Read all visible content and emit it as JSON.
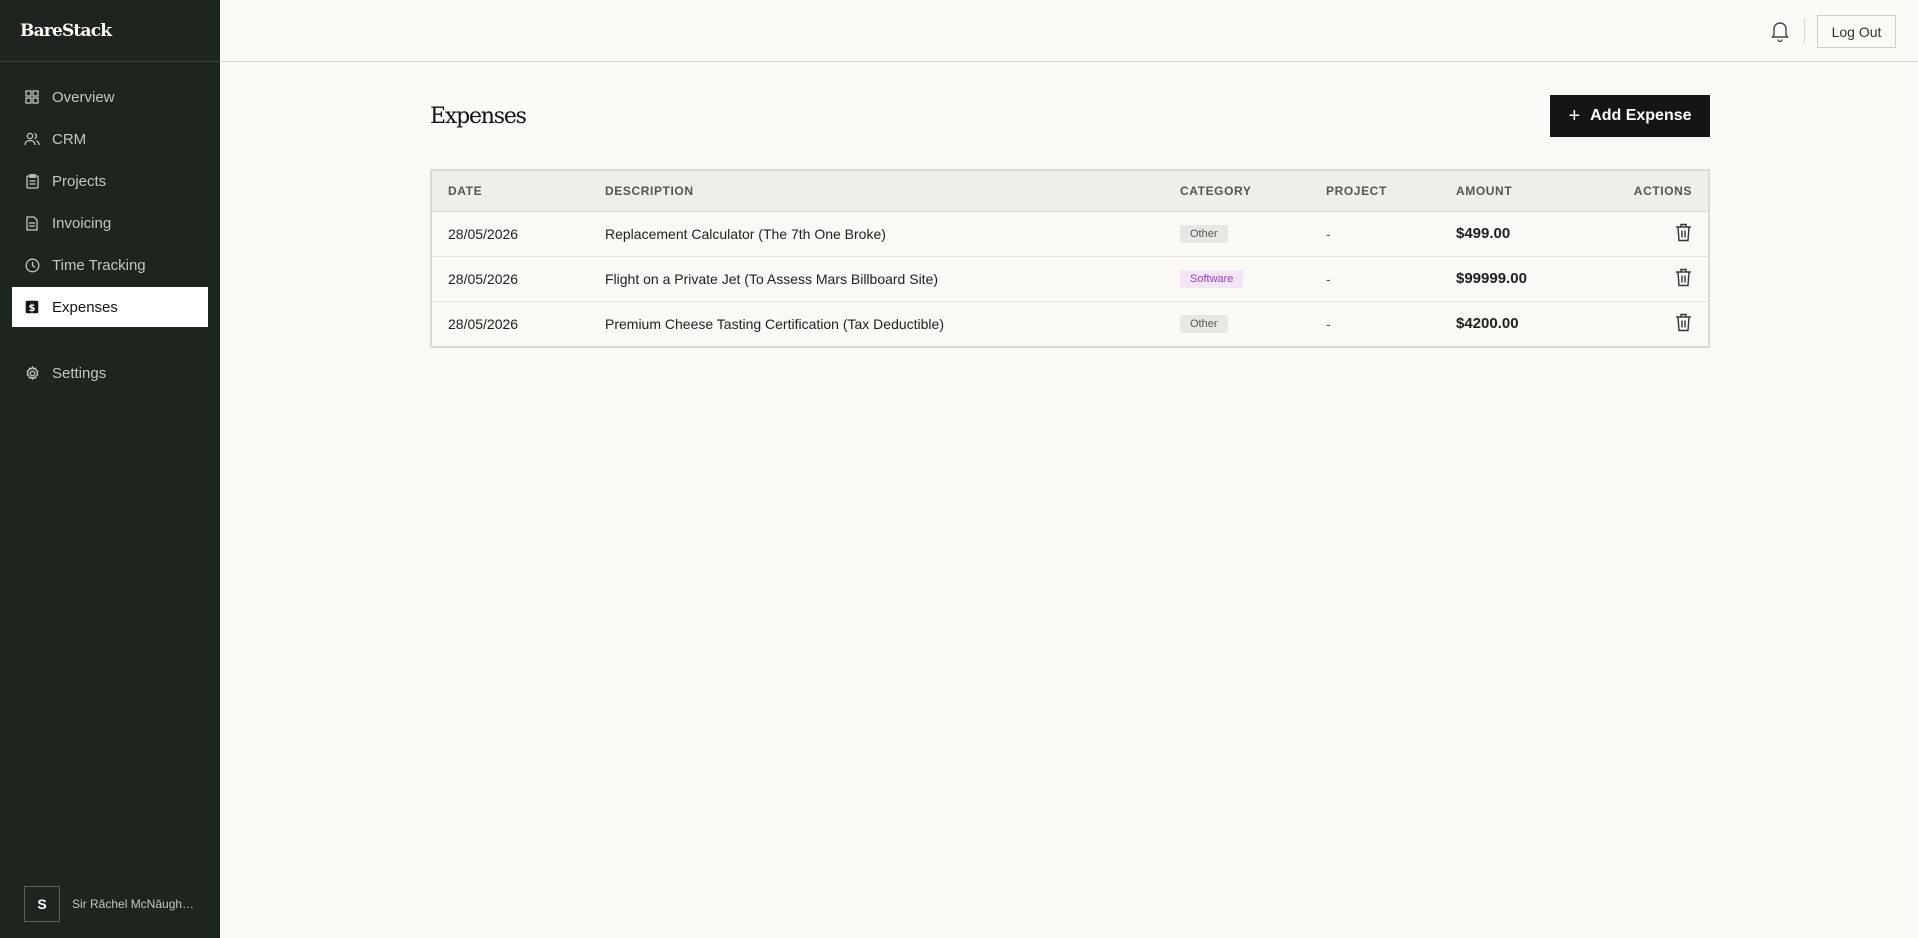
{
  "app": {
    "brand": "BareStack"
  },
  "sidebar": {
    "items": [
      {
        "label": "Overview",
        "icon": "grid-icon"
      },
      {
        "label": "CRM",
        "icon": "users-icon"
      },
      {
        "label": "Projects",
        "icon": "clipboard-icon"
      },
      {
        "label": "Invoicing",
        "icon": "file-icon"
      },
      {
        "label": "Time Tracking",
        "icon": "clock-icon"
      },
      {
        "label": "Expenses",
        "icon": "dollar-square-icon",
        "active": true
      },
      {
        "label": "Settings",
        "icon": "gear-icon"
      }
    ],
    "user": {
      "initial": "S",
      "name": "Sir Răchel McNăughton"
    }
  },
  "topbar": {
    "logout_label": "Log Out",
    "bell_icon": "bell-icon"
  },
  "page": {
    "title": "Expenses",
    "add_button_label": "Add Expense"
  },
  "table": {
    "columns": [
      "DATE",
      "DESCRIPTION",
      "CATEGORY",
      "PROJECT",
      "AMOUNT",
      "ACTIONS"
    ],
    "rows": [
      {
        "date": "28/05/2026",
        "description": "Replacement Calculator (The 7th One Broke)",
        "category": "Other",
        "project": "-",
        "amount": "$499.00"
      },
      {
        "date": "28/05/2026",
        "description": "Flight on a Private Jet (To Assess Mars Billboard Site)",
        "category": "Software",
        "project": "-",
        "amount": "$99999.00"
      },
      {
        "date": "28/05/2026",
        "description": "Premium Cheese Tasting Certification (Tax Deductible)",
        "category": "Other",
        "project": "-",
        "amount": "$4200.00"
      }
    ]
  },
  "colors": {
    "sidebar_bg": "#1e241e",
    "accent_dark": "#151515",
    "software_badge": "#9b3fc0"
  }
}
